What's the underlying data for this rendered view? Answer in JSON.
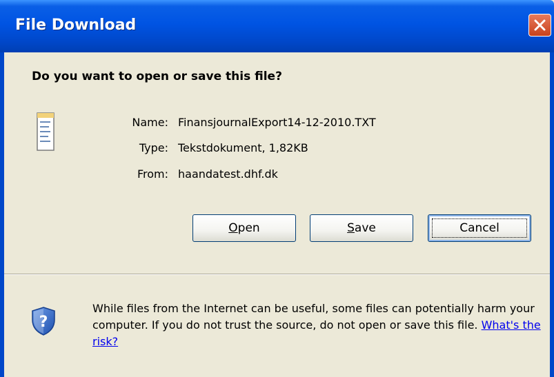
{
  "window": {
    "title": "File Download",
    "close_icon": "close-icon"
  },
  "dialog": {
    "question": "Do you want to open or save this file?",
    "file_icon": "text-document-icon",
    "fields": [
      {
        "label": "Name:",
        "value": "FinansjournalExport14-12-2010.TXT"
      },
      {
        "label": "Type:",
        "value": "Tekstdokument, 1,82KB"
      },
      {
        "label": "From:",
        "value": "haandatest.dhf.dk"
      }
    ],
    "buttons": {
      "open": {
        "accel": "O",
        "rest": "pen"
      },
      "save": {
        "accel": "S",
        "rest": "ave"
      },
      "cancel": "Cancel"
    },
    "warning": {
      "icon": "security-shield-question-icon",
      "text": "While files from the Internet can be useful, some files can potentially harm your computer. If you do not trust the source, do not open or save this file. ",
      "link": "What's the risk?"
    }
  },
  "colors": {
    "titlebar": "#0054e3",
    "dialog_bg": "#ece9d8",
    "link": "#0000ee",
    "close_button": "#c8421c"
  }
}
